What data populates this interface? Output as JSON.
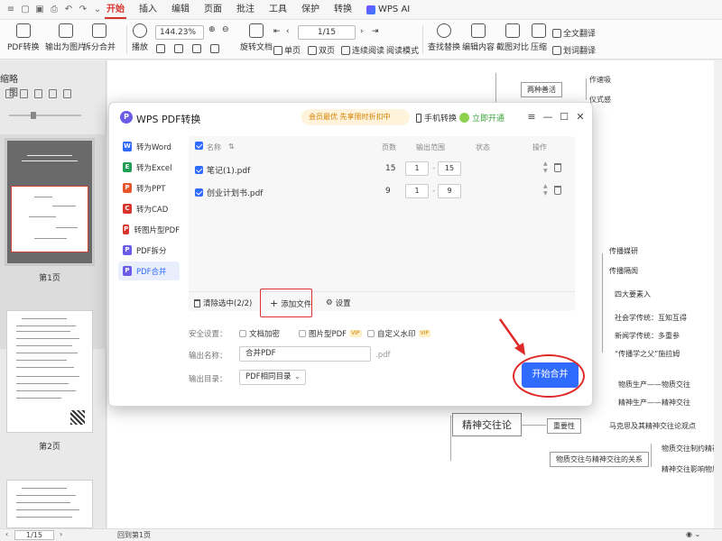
{
  "menubar": {
    "tabs": [
      "开始",
      "插入",
      "编辑",
      "页面",
      "批注",
      "工具",
      "保护",
      "转换"
    ],
    "active_tab": "开始",
    "wps_ai": "WPS AI"
  },
  "ribbon": {
    "pdf_convert": "PDF转换",
    "export_image": "输出为图片",
    "split_merge": "拆分合并",
    "play": "播放",
    "zoom": "144.23%",
    "page_indicator": "1/15",
    "rotate": "旋转文档",
    "single": "单页",
    "double": "双页",
    "continuous": "连续阅读",
    "reading_mode": "阅读模式",
    "find_replace": "查找替换",
    "edit_content": "编辑内容",
    "screenshot_compare": "截图对比",
    "compress": "压缩",
    "full_translate": "全文翻译",
    "word_translate": "划词翻译"
  },
  "leftpane": {
    "title": "缩略图",
    "page1_label": "第1页",
    "page2_label": "第2页"
  },
  "statusbar": {
    "page": "1/15",
    "back": "回到第1页"
  },
  "mindmap": {
    "n1": "两种善活",
    "n2": "作速吸",
    "n3": "仪式感",
    "n4": "传播媒研",
    "n5": "传播隔阂",
    "n6": "四大要素入",
    "n7": "社会学传统：互知互得",
    "n8": "新闻学传统：多重参",
    "n9": "“传播学之父”施拉姆",
    "n10": "物质生产——物质交往",
    "n11": "精神生产——精神交往",
    "center": "精神交往论",
    "n12": "重要性",
    "n13": "马克思及其精神交往论观点",
    "n14": "物质交往与精神交往的关系",
    "n15": "物质交往制约精神交往",
    "n16": "精神交往影响物质交往"
  },
  "dialog": {
    "logo": "P",
    "title": "WPS PDF转换",
    "banner": "会员最优 先享限时折扣中",
    "mobile": "手机转换",
    "vip_open": "立即开通",
    "sidebar": [
      {
        "label": "转为Word",
        "icon": "W",
        "color": "#2f6bff"
      },
      {
        "label": "转为Excel",
        "icon": "E",
        "color": "#1f9d55"
      },
      {
        "label": "转为PPT",
        "icon": "P",
        "color": "#e8552b"
      },
      {
        "label": "转为CAD",
        "icon": "C",
        "color": "#d9342b"
      },
      {
        "label": "转图片型PDF",
        "icon": "P",
        "color": "#d9342b"
      },
      {
        "label": "PDF拆分",
        "icon": "P",
        "color": "#6a5ce7"
      },
      {
        "label": "PDF合并",
        "icon": "P",
        "color": "#6a5ce7"
      }
    ],
    "active_side": "PDF合并",
    "table": {
      "col_name": "名称",
      "col_pages": "页数",
      "col_range": "输出范围",
      "col_status": "状态",
      "col_ops": "操作",
      "rows": [
        {
          "name": "笔记(1).pdf",
          "pages": "15",
          "from": "1",
          "to": "15"
        },
        {
          "name": "创业计划书.pdf",
          "pages": "9",
          "from": "1",
          "to": "9"
        }
      ]
    },
    "footer": {
      "clear": "清除选中(2/2)",
      "add_file": "添加文件",
      "settings": "设置"
    },
    "options": {
      "security_label": "安全设置：",
      "encrypt": "文档加密",
      "image_pdf": "图片型PDF",
      "watermark": "自定义水印",
      "vip": "VIP"
    },
    "output_name_label": "输出名称：",
    "output_name": "合并PDF",
    "ext": ".pdf",
    "output_dir_label": "输出目录：",
    "output_dir": "PDF相同目录",
    "start_button": "开始合并"
  },
  "colors": {
    "accent": "#2f6bff",
    "active_tab": "#d6342a",
    "highlight_red": "#e03030"
  }
}
